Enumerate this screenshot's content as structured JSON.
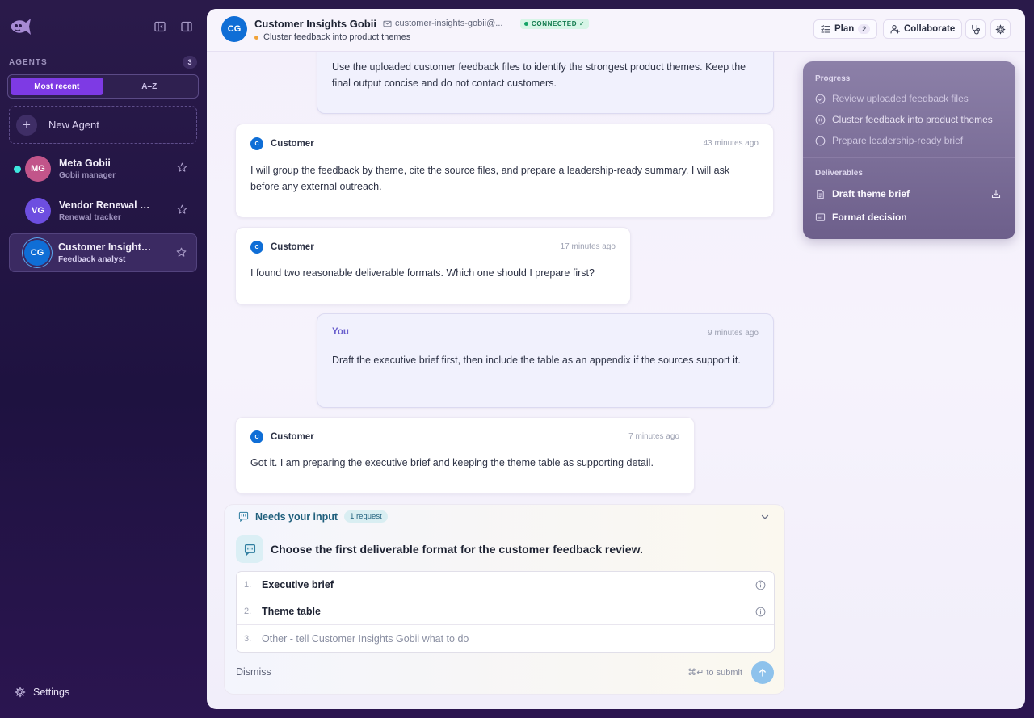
{
  "sidebar": {
    "agents_label": "AGENTS",
    "agents_count": "3",
    "sort_tabs": [
      "Most recent",
      "A–Z"
    ],
    "new_agent_label": "New Agent",
    "agents": [
      {
        "initials": "MG",
        "name": "Meta Gobii",
        "role": "Gobii manager",
        "color": "#c2558a"
      },
      {
        "initials": "VG",
        "name": "Vendor Renewal Gobii",
        "role": "Renewal tracker",
        "color": "#6d4ee0"
      },
      {
        "initials": "CG",
        "name": "Customer Insights Gobii",
        "role": "Feedback analyst",
        "color": "#0f6ed6"
      }
    ],
    "settings_label": "Settings"
  },
  "header": {
    "avatar": "CG",
    "title": "Customer Insights Gobii",
    "email": "customer-insights-gobii@...",
    "status": "CONNECTED ✓",
    "subtitle": "Cluster feedback into product themes",
    "plan_label": "Plan",
    "plan_count": "2",
    "collaborate_label": "Collaborate"
  },
  "messages": [
    {
      "body": "Use the uploaded customer feedback files to identify the strongest product themes. Keep the final output concise and do not contact customers."
    },
    {
      "avatar": "C",
      "author": "Customer",
      "time": "43 minutes ago",
      "body": "I will group the feedback by theme, cite the source files, and prepare a leadership-ready summary. I will ask before any external outreach."
    },
    {
      "avatar": "C",
      "author": "Customer",
      "time": "17 minutes ago",
      "body": "I found two reasonable deliverable formats. Which one should I prepare first?"
    },
    {
      "author": "You",
      "time": "9 minutes ago",
      "body": "Draft the executive brief first, then include the table as an appendix if the sources support it."
    },
    {
      "avatar": "C",
      "author": "Customer",
      "time": "7 minutes ago",
      "body": "Got it. I am preparing the executive brief and keeping the theme table as supporting detail."
    }
  ],
  "progress": {
    "progress_label": "Progress",
    "steps": [
      "Review uploaded feedback files",
      "Cluster feedback into product themes",
      "Prepare leadership-ready brief"
    ],
    "deliverables_label": "Deliverables",
    "deliverables": [
      "Draft theme brief",
      "Format decision"
    ]
  },
  "input_card": {
    "title": "Needs your input",
    "count": "1 request",
    "question": "Choose the first deliverable format for the customer feedback review.",
    "options": [
      {
        "num": "1.",
        "label": "Executive brief"
      },
      {
        "num": "2.",
        "label": "Theme table"
      },
      {
        "num": "3.",
        "label": "Other - tell Customer Insights Gobii what to do"
      }
    ],
    "dismiss_label": "Dismiss",
    "submit_hint": "⌘↵ to submit"
  }
}
